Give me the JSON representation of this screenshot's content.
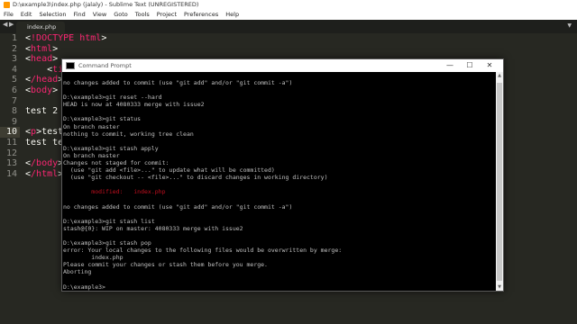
{
  "window_title": "D:\\example3\\index.php (jalaly) - Sublime Text (UNREGISTERED)",
  "menu": [
    "File",
    "Edit",
    "Selection",
    "Find",
    "View",
    "Goto",
    "Tools",
    "Project",
    "Preferences",
    "Help"
  ],
  "tab": {
    "label": "index.php"
  },
  "editor": {
    "line_numbers": [
      "1",
      "2",
      "3",
      "4",
      "5",
      "6",
      "7",
      "8",
      "9",
      "10",
      "11",
      "12",
      "13",
      "14"
    ],
    "current_line": "10",
    "lines": [
      "<!DOCTYPE html>",
      "<html>",
      "<head>",
      "    <ti",
      "</head>",
      "<body>",
      "",
      "test 2",
      "",
      "<p>test",
      "test te",
      "",
      "</body>",
      "</html>"
    ]
  },
  "cmd": {
    "title": "Command Prompt",
    "controls": {
      "minimize": "—",
      "maximize": "☐",
      "close": "✕"
    },
    "lines": [
      "no changes added to commit (use \"git add\" and/or \"git commit -a\")",
      "",
      "D:\\example3>git reset --hard",
      "HEAD is now at 4080333 merge with issue2",
      "",
      "D:\\example3>git status",
      "On branch master",
      "nothing to commit, working tree clean",
      "",
      "D:\\example3>git stash apply",
      "On branch master",
      "Changes not staged for commit:",
      "  (use \"git add <file>...\" to update what will be committed)",
      "  (use \"git checkout -- <file>...\" to discard changes in working directory)",
      "",
      "        modified:   index.php",
      "",
      "no changes added to commit (use \"git add\" and/or \"git commit -a\")",
      "",
      "D:\\example3>git stash list",
      "stash@{0}: WIP on master: 4080333 merge with issue2",
      "",
      "D:\\example3>git stash pop",
      "error: Your local changes to the following files would be overwritten by merge:",
      "        index.php",
      "Please commit your changes or stash them before you merge.",
      "Aborting",
      "",
      "D:\\example3>"
    ],
    "red_line_index": 15
  },
  "colors": {
    "editor_bg": "#272822",
    "tag": "#f92672",
    "terminal_bg": "#000000",
    "terminal_fg": "#c0c0c0",
    "modified": "#c50f1f"
  }
}
